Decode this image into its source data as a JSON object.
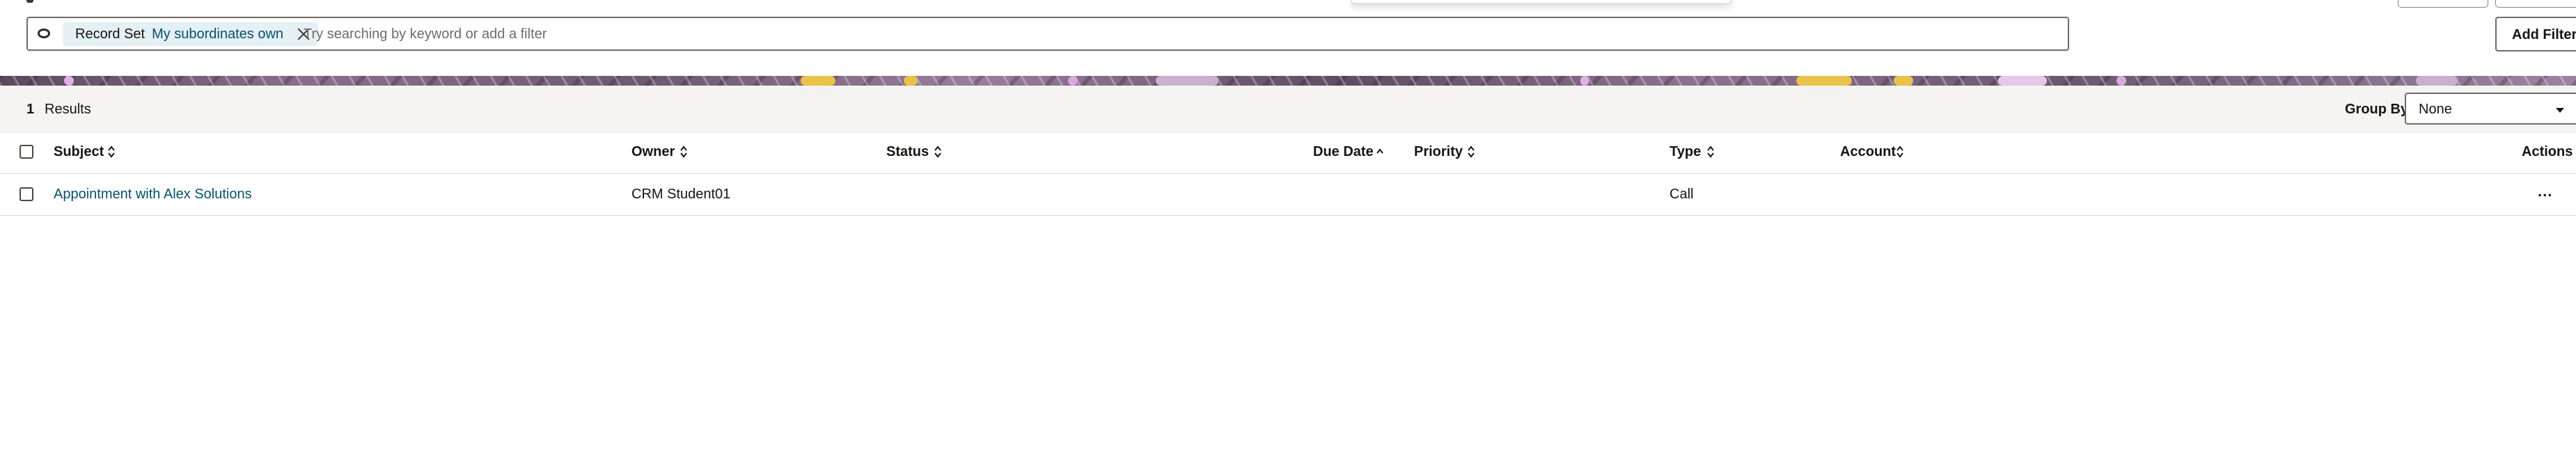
{
  "search": {
    "chip_label": "Record Set",
    "chip_value": "My subordinates own",
    "placeholder": "Try searching by keyword or add a filter",
    "add_filter_label": "Add Filter"
  },
  "toolbar": {
    "results_count": "1",
    "results_label": "Results",
    "group_by_label": "Group By",
    "group_by_value": "None"
  },
  "table": {
    "columns": [
      {
        "label": "Subject",
        "sort": "sortable"
      },
      {
        "label": "Owner",
        "sort": "sortable"
      },
      {
        "label": "Status",
        "sort": "sortable"
      },
      {
        "label": "Due Date",
        "sort": "ascending"
      },
      {
        "label": "Priority",
        "sort": "sortable"
      },
      {
        "label": "Type",
        "sort": "sortable"
      },
      {
        "label": "Account",
        "sort": "sortable"
      },
      {
        "label": "Actions",
        "sort": "none"
      }
    ],
    "rows": [
      {
        "subject": "Appointment with Alex Solutions",
        "owner": "CRM Student01",
        "status": "",
        "due_date": "",
        "priority": "",
        "type": "Call",
        "account": "",
        "actions": "..."
      }
    ]
  },
  "icons": {
    "filter": "filter-icon",
    "chip_close": "close-icon",
    "sort": "sort-icon",
    "sort_ascending": "sort-ascending-icon",
    "group_by_caret": "chevron-down-icon",
    "row_actions": "more-actions-icon"
  },
  "colors": {
    "link": "#06516c",
    "chip_background": "#e4f0f4",
    "toolbar_background": "#f5f4f2",
    "border": "#6f6b66"
  }
}
